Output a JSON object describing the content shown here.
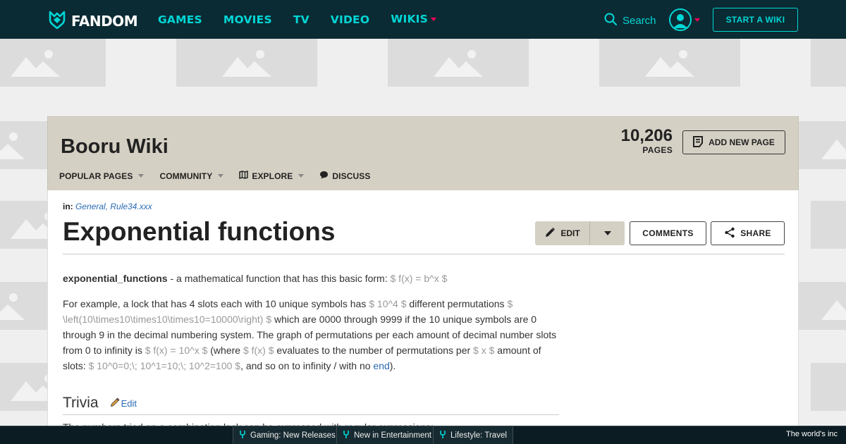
{
  "topnav": {
    "logo": "FANDOM",
    "links": [
      {
        "label": "GAMES"
      },
      {
        "label": "MOVIES"
      },
      {
        "label": "TV"
      },
      {
        "label": "VIDEO"
      },
      {
        "label": "WIKIS"
      }
    ],
    "search_label": "Search",
    "start_wiki_label": "START A WIKI"
  },
  "wiki": {
    "name": "Booru Wiki",
    "pages_count": "10,206",
    "pages_label": "PAGES",
    "add_page_label": "ADD NEW PAGE",
    "nav": [
      {
        "label": "POPULAR PAGES"
      },
      {
        "label": "COMMUNITY"
      },
      {
        "label": "EXPLORE"
      },
      {
        "label": "DISCUSS"
      }
    ]
  },
  "page": {
    "categories_prefix": "in:",
    "categories": "General, Rule34.xxx",
    "title": "Exponential functions",
    "edit_label": "EDIT",
    "comments_label": "COMMENTS",
    "share_label": "SHARE"
  },
  "article": {
    "p1_term": "exponential_functions",
    "p1_text": " - a mathematical function that has this basic form: ",
    "p1_math": "$ f(x) = b^x $",
    "p2_a": "For example, a lock that has 4 slots each with 10 unique symbols has ",
    "p2_m1": "$ 10^4 $",
    "p2_b": " different permutations ",
    "p2_m2": "$ \\left(10\\times10\\times10\\times10=10000\\right) $",
    "p2_c": " which are 0000 through 9999 if the 10 unique symbols are 0 through 9 in the decimal numbering system. The graph of permutations per each amount of decimal number slots from 0 to infinity is ",
    "p2_m3": "$ f(x) = 10^x $",
    "p2_d": " (where ",
    "p2_m4": "$ f(x) $",
    "p2_e": " evaluates to the number of permutations per ",
    "p2_m5": "$ x $",
    "p2_f": " amount of slots: ",
    "p2_m6": "$ 10^0=0;\\; 10^1=10;\\; 10^2=100 $",
    "p2_g": ", and so on to infinity / with no ",
    "p2_link": "end",
    "p2_h": ").",
    "section_heading": "Trivia",
    "section_edit": "Edit",
    "cut_text": "The numbers tried on a combination lock can be expressed with regular expressions:"
  },
  "bottombar": {
    "items": [
      {
        "label": "Gaming: New Releases"
      },
      {
        "label": "New in Entertainment"
      },
      {
        "label": "Lifestyle: Travel"
      }
    ],
    "ticker": "The world's inc"
  },
  "colors": {
    "nav_bg": "#0a2b33",
    "accent": "#00d6d6",
    "pink": "#fa005a",
    "wiki_header_bg": "#d5d0c4",
    "link": "#2a6bb3"
  }
}
